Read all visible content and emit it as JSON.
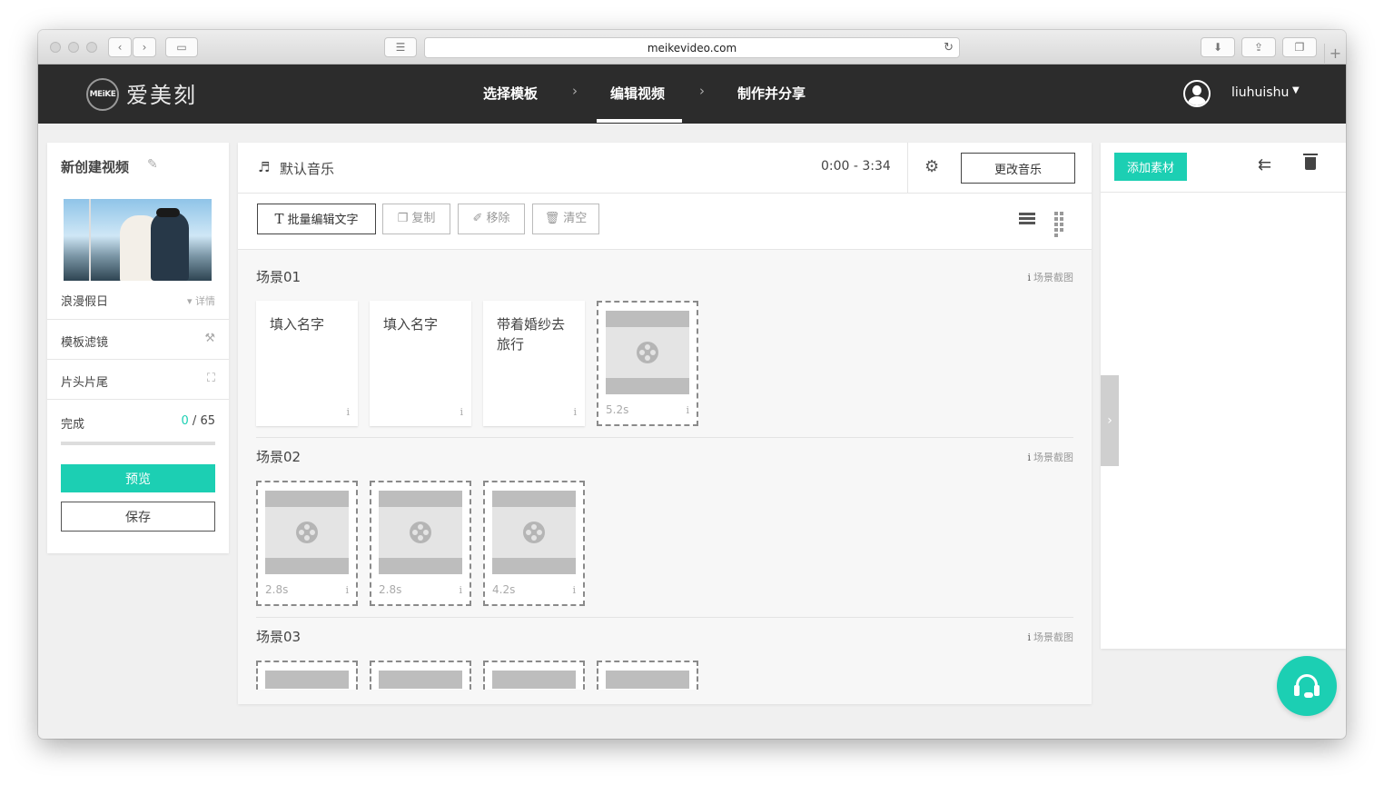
{
  "browser": {
    "url": "meikevideo.com"
  },
  "nav": {
    "logo_badge": "MEiKE",
    "logo_text": "爱美刻",
    "steps": [
      "选择模板",
      "编辑视频",
      "制作并分享"
    ],
    "active_step": "编辑视频",
    "username": "liuhuishu"
  },
  "left": {
    "project_title": "新创建视频",
    "template_name": "浪漫假日",
    "details_label": "详情",
    "filter_label": "模板滤镜",
    "intro_outro_label": "片头片尾",
    "done_label": "完成",
    "done_count": "0",
    "total_count": "65",
    "preview_label": "预览",
    "save_label": "保存"
  },
  "music": {
    "label": "默认音乐",
    "time_range": "0:00 - 3:34",
    "change_label": "更改音乐"
  },
  "toolbar": {
    "batch_edit": "批量编辑文字",
    "copy": "复制",
    "remove": "移除",
    "clear": "清空"
  },
  "scenes": [
    {
      "title": "场景01",
      "screenshot_label": "场景截图",
      "cards": [
        {
          "type": "text",
          "text": "填入名字"
        },
        {
          "type": "text",
          "text": "填入名字"
        },
        {
          "type": "text",
          "text": "带着婚纱去旅行"
        },
        {
          "type": "media",
          "duration": "5.2s"
        }
      ]
    },
    {
      "title": "场景02",
      "screenshot_label": "场景截图",
      "cards": [
        {
          "type": "media",
          "duration": "2.8s"
        },
        {
          "type": "media",
          "duration": "2.8s"
        },
        {
          "type": "media",
          "duration": "4.2s"
        }
      ]
    },
    {
      "title": "场景03",
      "screenshot_label": "场景截图",
      "cards": [
        {
          "type": "media",
          "duration": ""
        },
        {
          "type": "media",
          "duration": ""
        },
        {
          "type": "media",
          "duration": ""
        },
        {
          "type": "media",
          "duration": ""
        }
      ]
    }
  ],
  "right": {
    "add_material": "添加素材"
  },
  "colors": {
    "accent": "#1ccfb3",
    "nav_bg": "#2c2c2c"
  }
}
